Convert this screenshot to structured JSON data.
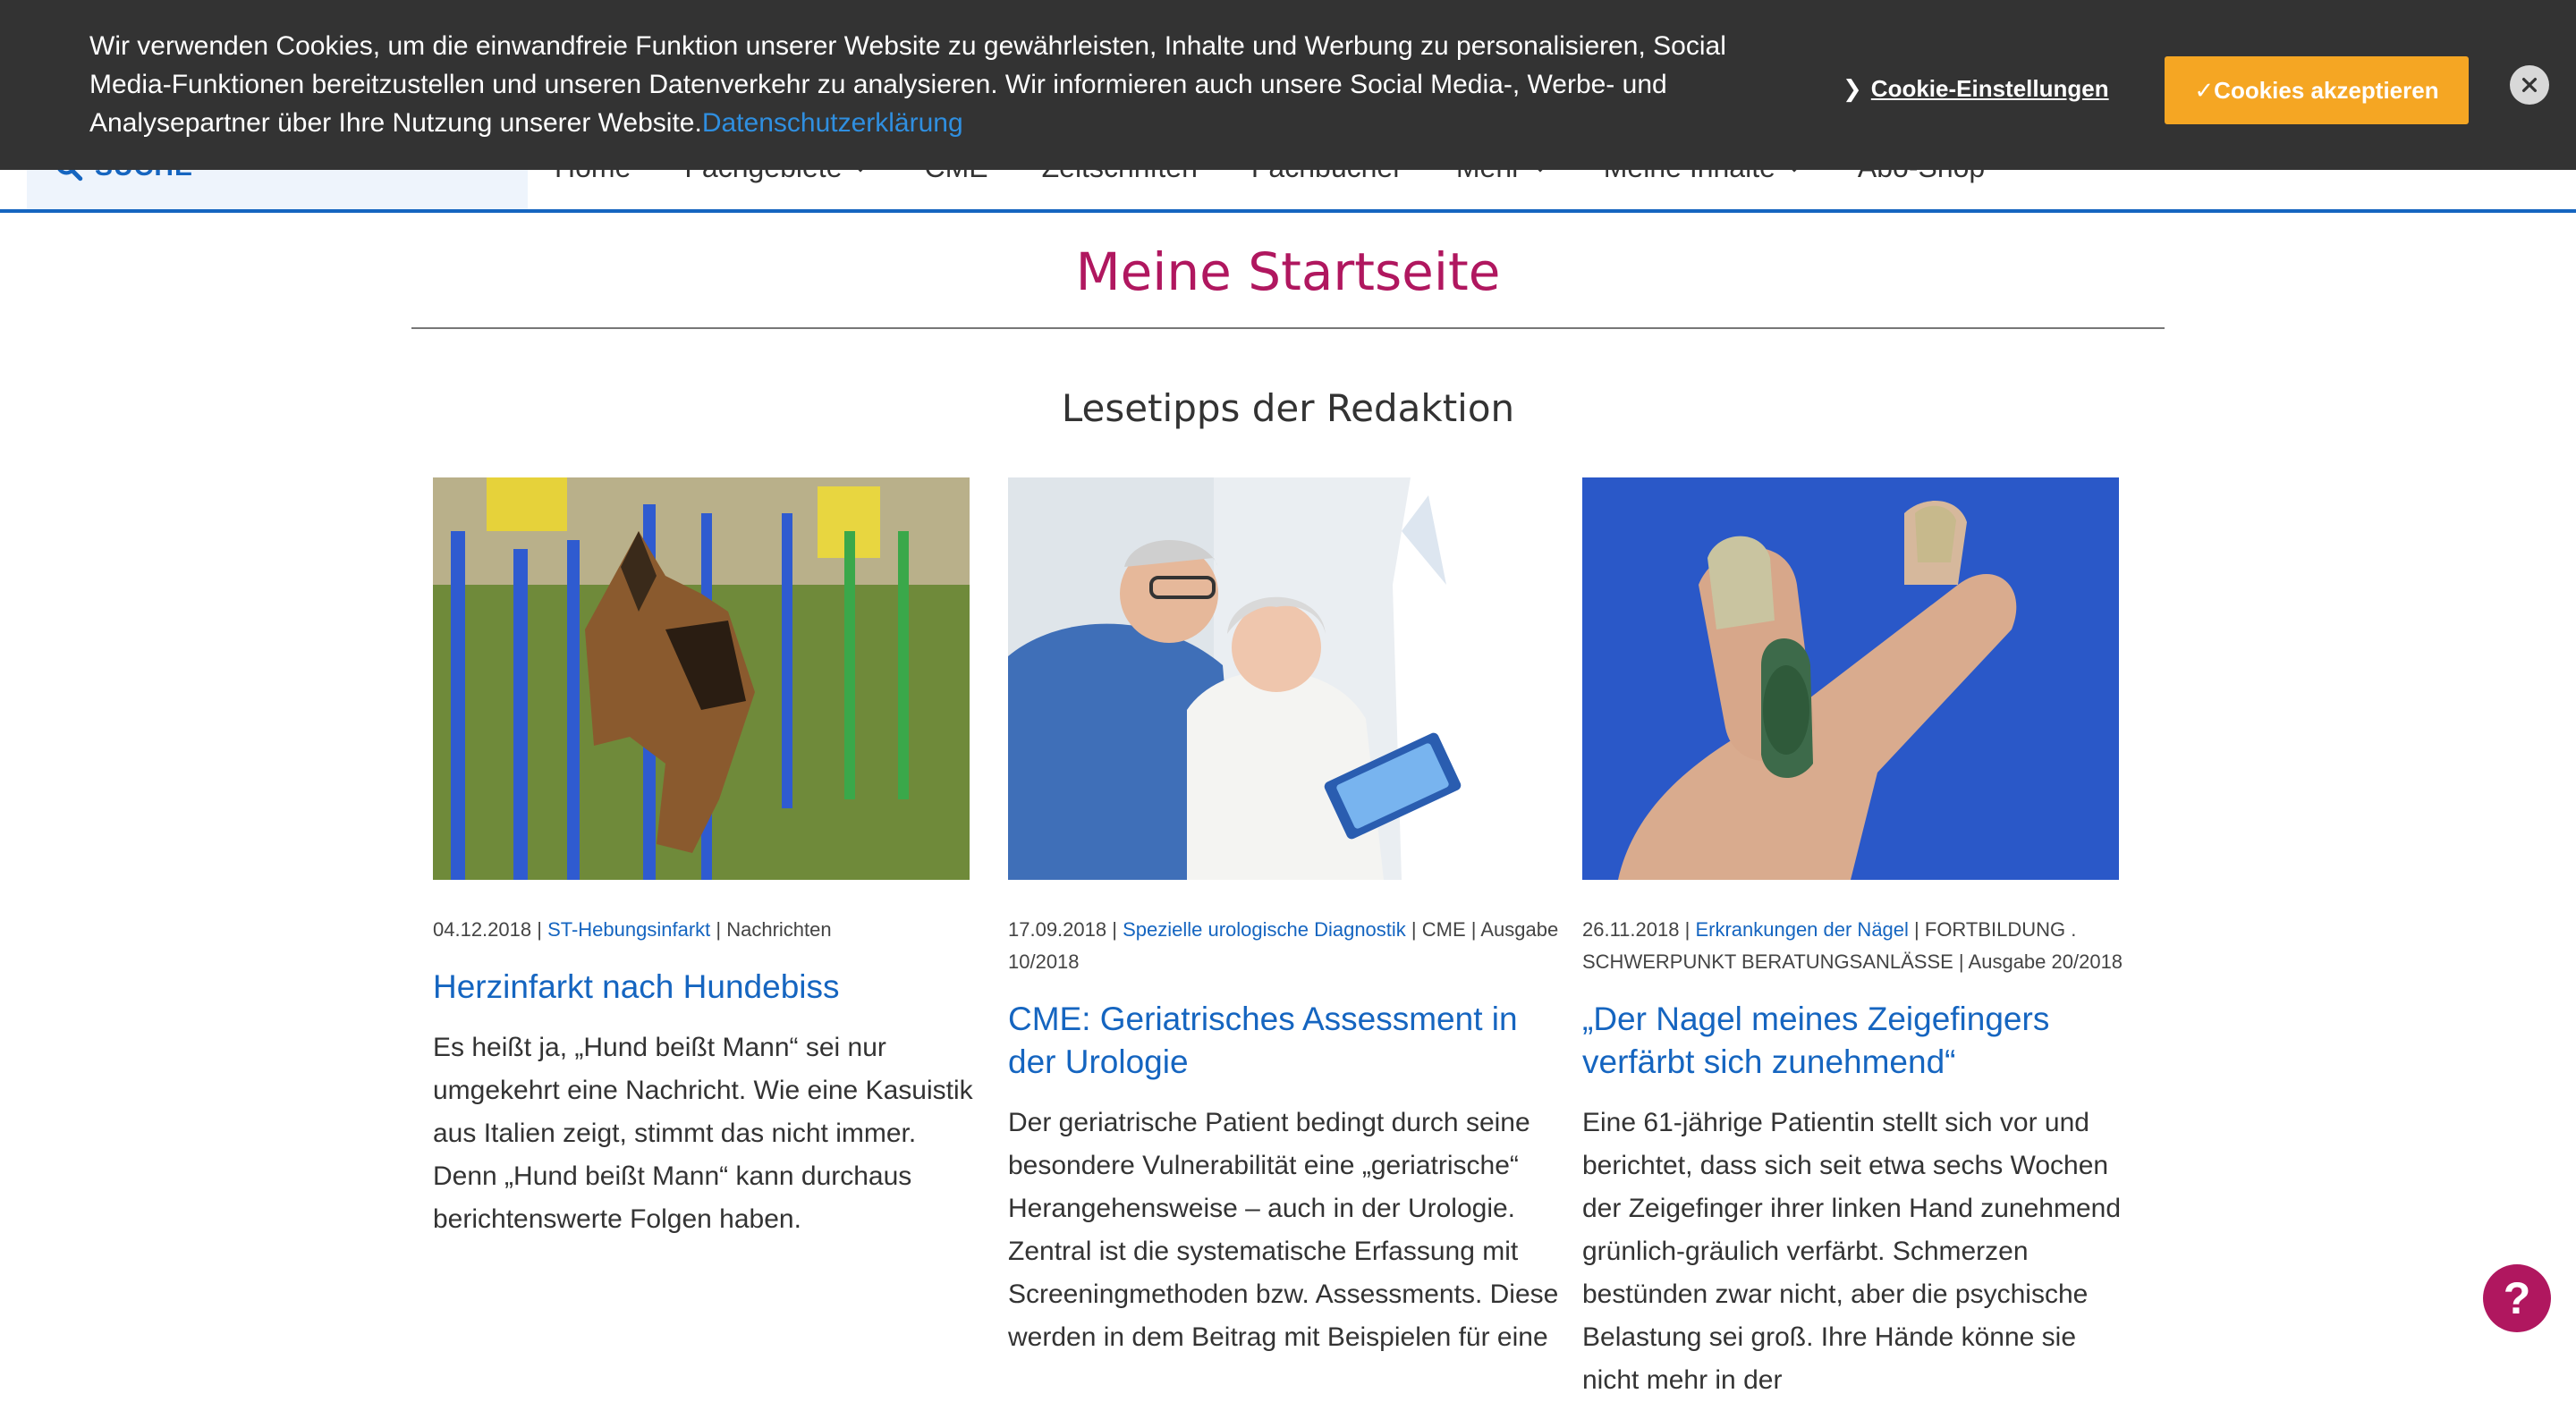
{
  "nav": {
    "search_label": "SUCHE",
    "items": [
      {
        "label": "Home",
        "dropdown": false
      },
      {
        "label": "Fachgebiete",
        "dropdown": true
      },
      {
        "label": "CME",
        "dropdown": false
      },
      {
        "label": "Zeitschriften",
        "dropdown": false
      },
      {
        "label": "Fachbücher",
        "dropdown": false
      },
      {
        "label": "Mehr",
        "dropdown": true
      },
      {
        "label": "Meine Inhalte",
        "dropdown": true
      },
      {
        "label": "Abo-Shop",
        "dropdown": false
      }
    ]
  },
  "cookie_banner": {
    "text": "Wir verwenden Cookies, um die einwandfreie Funktion unserer Website zu gewährleisten, Inhalte und Werbung zu personalisieren, Social Media-Funktionen bereitzustellen und unseren Datenverkehr zu analysieren. Wir informieren auch unsere Social Media-, Werbe- und Analysepartner über Ihre Nutzung unserer Website.",
    "privacy_link": "Datenschutzerklärung",
    "settings_label": "Cookie-Einstellungen",
    "accept_label": "✓Cookies akzeptieren"
  },
  "page": {
    "title": "Meine Startseite",
    "section_title": "Lesetipps der Redaktion"
  },
  "articles": [
    {
      "date": "04.12.2018",
      "category": "ST-Hebungsinfarkt",
      "meta_rest": "Nachrichten",
      "title": "Herzinfarkt nach Hundebiss",
      "teaser": "Es heißt ja, „Hund beißt Mann“ sei nur umgekehrt eine Nachricht. Wie eine Kasuistik aus Italien zeigt, stimmt das nicht immer. Denn „Hund beißt Mann“ kann durchaus berichtenswerte Folgen haben."
    },
    {
      "date": "17.09.2018",
      "category": "Spezielle urologische Diagnostik",
      "meta_rest": "CME | Ausgabe 10/2018",
      "title": "CME: Geriatrisches Assessment in der Urologie",
      "teaser": "Der geriatrische Patient bedingt durch seine besondere Vulnerabilität eine „geriatrische“ Herangehensweise – auch in der Urologie. Zentral ist die systematische Erfassung mit Screeningmethoden bzw. Assessments. Diese werden in dem Beitrag mit Beispielen für eine"
    },
    {
      "date": "26.11.2018",
      "category": "Erkrankungen der Nägel",
      "meta_rest": "FORTBILDUNG . SCHWERPUNKT BERATUNGSANLÄSSE | Ausgabe 20/2018",
      "title": "„Der Nagel meines Zeigefingers verfärbt sich zunehmend“",
      "teaser": "Eine 61-jährige Patientin stellt sich vor und berichtet, dass sich seit etwa sechs Wochen der Zeigefinger ihrer linken Hand zunehmend grünlich-gräulich verfärbt. Schmerzen bestünden zwar nicht, aber die psychische Belastung sei groß. Ihre Hände könne sie nicht mehr in der"
    }
  ],
  "help": {
    "label": "?"
  },
  "colors": {
    "accent_blue": "#1565c0",
    "brand_magenta": "#b0175f",
    "cookie_bg": "#333333",
    "accept_orange": "#f5a623"
  }
}
